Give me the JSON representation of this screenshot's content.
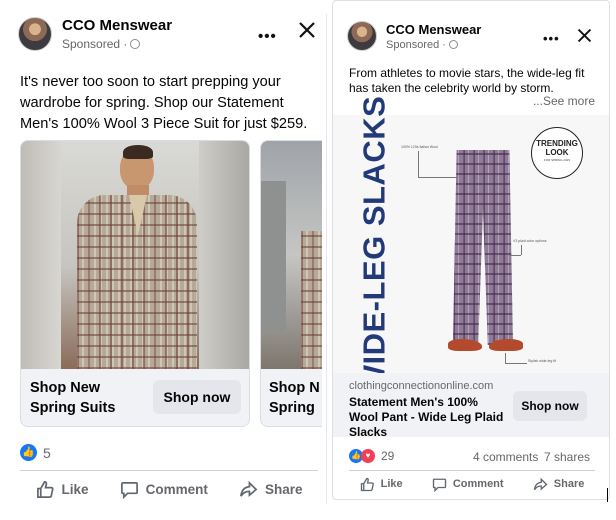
{
  "posts": [
    {
      "brand": "CCO Menswear",
      "sponsored": "Sponsored ·",
      "text": "It's never too soon to start prepping your wardrobe for spring. Shop our Statement Men's 100% Wool 3 Piece Suit for just $259.",
      "carousel": [
        {
          "title_line1": "Shop New",
          "title_line2": "Spring Suits",
          "button": "Shop now"
        },
        {
          "title_line1": "Shop N",
          "title_line2": "Spring"
        }
      ],
      "reaction_count": "5",
      "actions": {
        "like": "Like",
        "comment": "Comment",
        "share": "Share"
      }
    },
    {
      "brand": "CCO Menswear",
      "sponsored": "Sponsored ·",
      "text": "From athletes to movie stars, the wide-leg fit has taken the celebrity world by storm.",
      "see_more": "...See more",
      "ad_image": {
        "headline": "WIDE-LEG SLACKS",
        "badge_line1": "TRENDING",
        "badge_line2": "LOOK",
        "badge_line3": "FOR SPRING 2023",
        "note_top": "100% 120s Italian Wool",
        "note_mid": "V3 plaid color options",
        "note_bottom": "Stylish wide-leg fit"
      },
      "link": {
        "domain": "clothingconnectiononline.com",
        "title": "Statement Men's 100% Wool Pant - Wide Leg Plaid Slacks",
        "button": "Shop now"
      },
      "reaction_count": "29",
      "comments": "4 comments",
      "shares": "7 shares",
      "actions": {
        "like": "Like",
        "comment": "Comment",
        "share": "Share"
      }
    }
  ]
}
